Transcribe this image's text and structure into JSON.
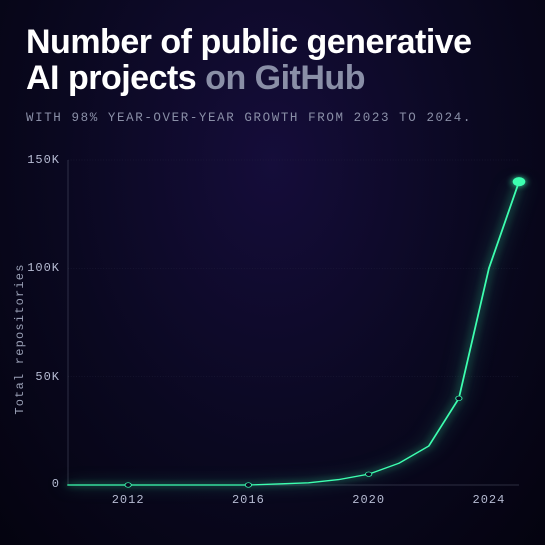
{
  "title_line1": "Number of public generative",
  "title_line2a": "AI projects ",
  "title_line2b": "on GitHub",
  "subtitle": "WITH 98% YEAR-OVER-YEAR GROWTH FROM 2023 TO 2024.",
  "ylabel": "Total repositories",
  "yticks": [
    "0",
    "50K",
    "100K",
    "150K"
  ],
  "xticks": [
    "2012",
    "2016",
    "2020",
    "2024"
  ],
  "chart_data": {
    "type": "line",
    "title": "Number of public generative AI projects on GitHub",
    "xlabel": "",
    "ylabel": "Total repositories",
    "ylim": [
      0,
      150000
    ],
    "xlim": [
      2010,
      2025
    ],
    "grid": "dashed",
    "x": [
      2010,
      2011,
      2012,
      2013,
      2014,
      2015,
      2016,
      2017,
      2018,
      2019,
      2020,
      2021,
      2022,
      2023,
      2024,
      2025
    ],
    "values": [
      0,
      0,
      0,
      0,
      0,
      0,
      0,
      500,
      1000,
      2500,
      5000,
      10000,
      18000,
      40000,
      100000,
      140000
    ],
    "annotations": [
      "98% year-over-year growth from 2023 to 2024"
    ]
  }
}
